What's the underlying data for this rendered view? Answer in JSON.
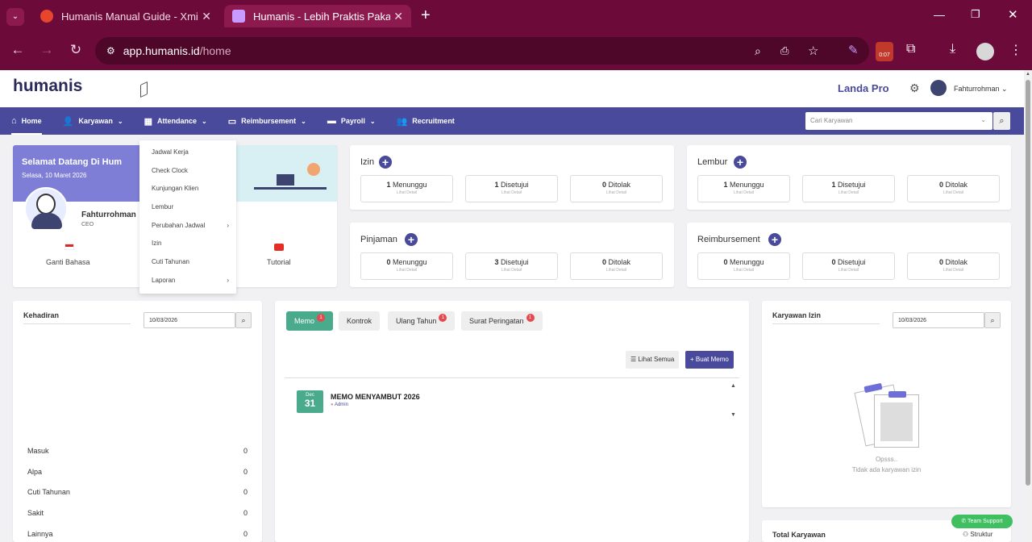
{
  "browser": {
    "tabs": [
      {
        "title": "Humanis Manual Guide - Xmind"
      },
      {
        "title": "Humanis - Lebih Praktis Pakai H"
      }
    ],
    "new_tab": "+",
    "url_host": "app.humanis.id",
    "url_path": "/home",
    "ext_badge": "0:07",
    "colors": {
      "frame": "#6c0a3a",
      "urlbar": "#4e0729"
    }
  },
  "header": {
    "logo": "humanis",
    "company": "Landa Pro",
    "user": "Fahturrohman"
  },
  "menu": {
    "items": [
      {
        "label": "Home",
        "icon": "home-icon"
      },
      {
        "label": "Karyawan",
        "icon": "user-edit-icon"
      },
      {
        "label": "Attendance",
        "icon": "calendar-icon"
      },
      {
        "label": "Reimbursement",
        "icon": "money-icon"
      },
      {
        "label": "Payroll",
        "icon": "folder-icon"
      },
      {
        "label": "Recruitment",
        "icon": "users-icon"
      }
    ],
    "search_placeholder": "Cari Karyawan",
    "color": "#4a4a9c"
  },
  "attendance_menu": {
    "items": [
      "Jadwal Kerja",
      "Check Clock",
      "Kunjungan Klien",
      "Lembur",
      "Perubahan Jadwal",
      "Izin",
      "Cuti Tahunan",
      "Laporan"
    ]
  },
  "welcome": {
    "greeting": "Selamat Datang Di Hum",
    "date": "Selasa, 10 Maret 2026",
    "name": "Fahturrohman",
    "role": "CEO",
    "links": [
      "Ganti Bahasa",
      "Tutorial"
    ]
  },
  "izin": {
    "title": "Izin",
    "stats": [
      {
        "num": "1",
        "label": "Menunggu"
      },
      {
        "num": "1",
        "label": "Disetujui"
      },
      {
        "num": "0",
        "label": "Ditolak"
      }
    ]
  },
  "lembur": {
    "title": "Lembur",
    "stats": [
      {
        "num": "1",
        "label": "Menunggu"
      },
      {
        "num": "1",
        "label": "Disetujui"
      },
      {
        "num": "0",
        "label": "Ditolak"
      }
    ]
  },
  "pinjaman": {
    "title": "Pinjaman",
    "stats": [
      {
        "num": "0",
        "label": "Menunggu"
      },
      {
        "num": "3",
        "label": "Disetujui"
      },
      {
        "num": "0",
        "label": "Ditolak"
      }
    ]
  },
  "reimbursement": {
    "title": "Reimbursement",
    "stats": [
      {
        "num": "0",
        "label": "Menunggu"
      },
      {
        "num": "0",
        "label": "Disetujui"
      },
      {
        "num": "0",
        "label": "Ditolak"
      }
    ]
  },
  "detail_label": "Lihat Detail",
  "kehadiran": {
    "title": "Kehadiran",
    "date": "10/03/2026",
    "rows": [
      {
        "label": "Masuk",
        "value": "0"
      },
      {
        "label": "Alpa",
        "value": "0"
      },
      {
        "label": "Cuti Tahunan",
        "value": "0"
      },
      {
        "label": "Sakit",
        "value": "0"
      },
      {
        "label": "Lainnya",
        "value": "0"
      }
    ]
  },
  "memo": {
    "tabs": [
      {
        "label": "Memo",
        "badge": "1"
      },
      {
        "label": "Kontrok",
        "badge": ""
      },
      {
        "label": "Ulang Tahun",
        "badge": "1"
      },
      {
        "label": "Surat Peringatan",
        "badge": "1"
      }
    ],
    "see_all": "Lihat Semua",
    "create": "Buat Memo",
    "items": [
      {
        "month": "Dec",
        "day": "31",
        "title": "MEMO MENYAMBUT 2026",
        "author": "Admin"
      }
    ]
  },
  "karyawan_izin": {
    "title": "Karyawan Izin",
    "date": "10/03/2026",
    "empty1": "Opsss..",
    "empty2": "Tidak ada karyawan izin"
  },
  "total": {
    "title": "Total Karyawan",
    "link": "Struktur"
  },
  "support": "Team Support"
}
